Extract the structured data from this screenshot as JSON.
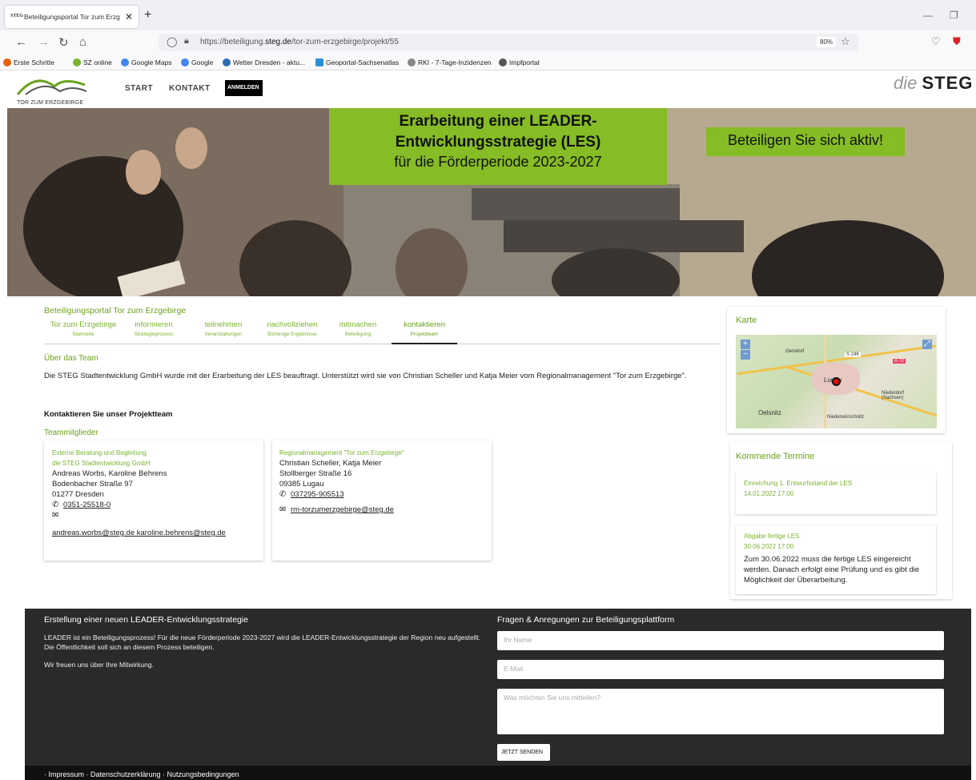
{
  "browser": {
    "tab_title": "Beteiligungsportal Tor zum Erzg",
    "tab_favicon": "STEG",
    "url_prefix": "https://beteiligung.",
    "url_domain": "steg.de",
    "url_path": "/tor-zum-erzgebirge/projekt/55",
    "zoom": "80%",
    "bookmarks": [
      {
        "label": "Erste Schritte",
        "color": "#e66000"
      },
      {
        "label": "SZ online",
        "color": "#7ab32e"
      },
      {
        "label": "Google Maps",
        "color": "#4285f4"
      },
      {
        "label": "Google",
        "color": "#4285f4"
      },
      {
        "label": "Wetter Dresden - aktu...",
        "color": "#2b6cb0"
      },
      {
        "label": "Geoportal-Sachsenatlas",
        "color": "#2b8fd6"
      },
      {
        "label": "RKI - 7-Tage-Inzidenzen",
        "color": "#888888"
      },
      {
        "label": "Impfportal",
        "color": "#555555"
      }
    ]
  },
  "header": {
    "logo_caption": "TOR ZUM ERZGEBIRGE",
    "nav": [
      "START",
      "KONTAKT"
    ],
    "login_label": "ANMELDEN",
    "brand_prefix": "die",
    "brand_name": "STEG"
  },
  "hero": {
    "line1": "Erarbeitung einer LEADER-",
    "line2": "Entwicklungsstrategie (LES)",
    "line3": "für die Förderperiode 2023-2027",
    "cta": "Beteiligen Sie sich aktiv!",
    "accent_color": "#86bc25"
  },
  "portal": {
    "title": "Beteiligungsportal Tor zum Erzgebirge",
    "tabs": [
      {
        "label": "Tor zum Erzgebirge",
        "sub": "Startseite"
      },
      {
        "label": "informieren",
        "sub": "Strategieprozess"
      },
      {
        "label": "teilnehmen",
        "sub": "Veranstaltungen"
      },
      {
        "label": "nachvollziehen",
        "sub": "Bisherige Ergebnisse"
      },
      {
        "label": "mitmachen",
        "sub": "Beteiligung"
      },
      {
        "label": "kontaktieren",
        "sub": "Projektteam"
      }
    ],
    "section_title": "Über das Team",
    "intro": "Die STEG Stadtentwicklung GmbH wurde mit der Erarbeitung der LES beauftragt. Unterstützt wird sie von Christian Scheller und Katja Meier vom Regionalmanagement \"Tor zum Erzgebirge\".",
    "contact_heading": "Kontaktieren Sie unser Projektteam",
    "members_heading": "Teammitglieder"
  },
  "cards": [
    {
      "label1": "Externe Beratung und Begleitung",
      "label2": "die STEG Stadtentwicklung GmbH",
      "names": "Andreas Worbs, Karoline Behrens",
      "street": "Bodenbacher Straße 97",
      "city": "01277 Dresden",
      "phone": "0351-25518-0",
      "email": "andreas.worbs@steg.de karoline.behrens@steg.de"
    },
    {
      "label1": "Regionalmanagement \"Tor zum Erzgebirge\"",
      "names": "Christian Scheller, Katja Meier",
      "street": "Stollberger Straße 16",
      "city": "09385 Lugau",
      "phone": "037295-905513",
      "email": "rm-torzumerzgebirge@steg.de"
    }
  ],
  "sidebar": {
    "map_title": "Karte",
    "map_labels": [
      "Gersdorf",
      "S 246",
      "A 72",
      "Lugau",
      "Niederdorf (Sachsen)",
      "Oelsnitz",
      "Niederwürschnitz"
    ],
    "events_title": "Kommende Termine",
    "events": [
      {
        "title": "Einreichung 1. Entwurfsstand der LES",
        "date": "14.01.2022 17:00",
        "text": ""
      },
      {
        "title": "Abgabe fertige LES",
        "date": "30.06.2022 17:00",
        "text": "Zum 30.06.2022 muss die fertige LES eingereicht werden. Danach erfolgt eine Prüfung und es gibt die Möglichkeit der Überarbeitung."
      }
    ]
  },
  "footer": {
    "left_title": "Erstellung einer neuen LEADER-Entwicklungsstrategie",
    "left_text1": "LEADER ist ein Beteiligungsprozess! Für die neue Förderperiode 2023-2027 wird die LEADER-Entwicklungsstrategie der Region neu aufgestellt. Die Öffentlichkeit soll sich an diesem Prozess beteiligen.",
    "left_text2": "Wir freuen uns über Ihre Mitwirkung.",
    "right_title": "Fragen & Anregungen zur Beteiligungsplattform",
    "name_placeholder": "Ihr Name",
    "email_placeholder": "E-Mail",
    "message_placeholder": "Was möchten Sie uns mitteilen?",
    "send_label": "JETZT SENDEN",
    "bottom_links": "· Impressum · Datenschutzerklärung · Nutzungsbedingungen"
  }
}
